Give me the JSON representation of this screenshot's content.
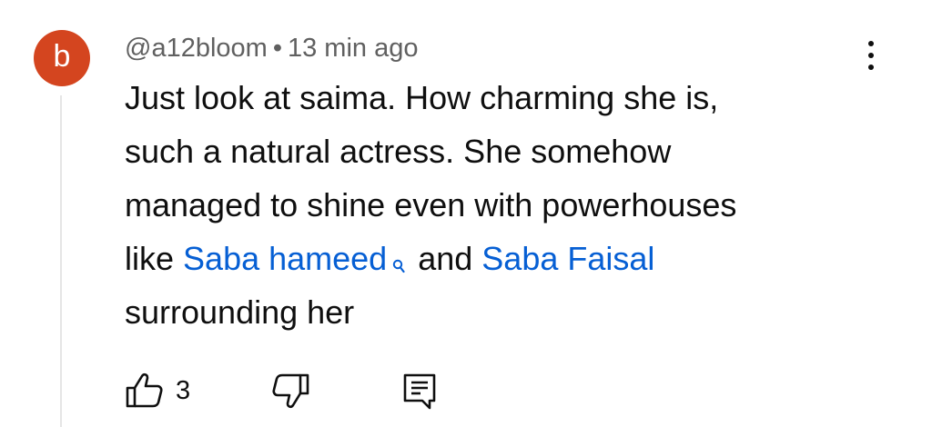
{
  "comment": {
    "avatar_letter": "b",
    "avatar_color": "#d4451f",
    "author": "@a12bloom",
    "separator": "•",
    "time": "13 min ago",
    "body": {
      "line1": "Just look at saima. How charming she is,",
      "line2": "such a natural actress. She somehow",
      "line3": "managed to shine even with powerhouses",
      "line4_prefix": "like ",
      "link1": "Saba hameed",
      "line4_middle": "and ",
      "link2": "Saba Faisal",
      "line5": "surrounding her"
    },
    "link_color": "#065fd4",
    "like_count": "3"
  },
  "icons": {
    "more": "more-vert-icon",
    "search": "search-icon",
    "like": "thumb-up-icon",
    "dislike": "thumb-down-icon",
    "reply": "reply-comment-icon"
  }
}
